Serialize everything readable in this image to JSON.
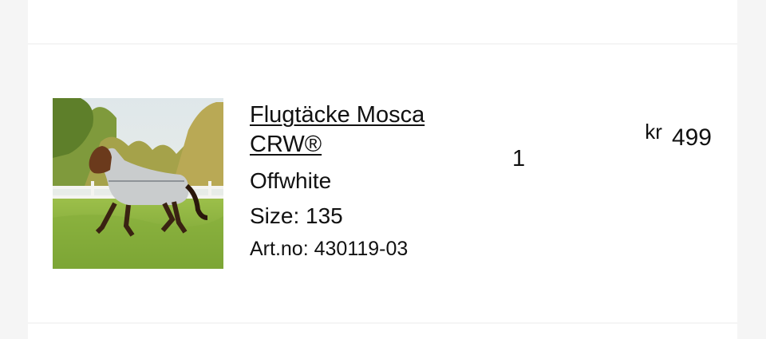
{
  "cart_item": {
    "image_alt": "Horse wearing fly rug in meadow",
    "name": "Flugtäcke Mosca CRW®",
    "variant": "Offwhite",
    "size_label": "Size:",
    "size_value": "135",
    "artno_label": "Art.no:",
    "artno_value": "430119-03",
    "quantity": "1",
    "price_currency": "kr",
    "price_value": "499"
  },
  "colors": {
    "page_background": "#f5f5f5",
    "panel_background": "#ffffff",
    "text": "#111111"
  }
}
